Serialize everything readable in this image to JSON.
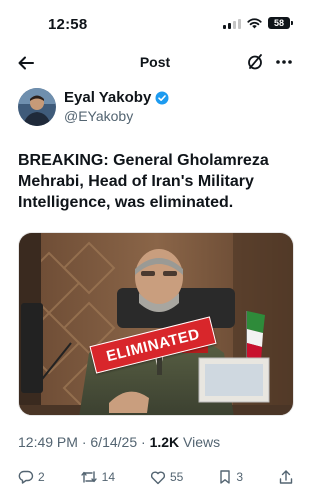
{
  "status_bar": {
    "time": "12:58",
    "battery": "58"
  },
  "nav": {
    "title": "Post",
    "back_icon": "back-arrow-icon",
    "grok_icon": "grok-icon",
    "more_icon": "more-icon"
  },
  "author": {
    "display_name": "Eyal Yakoby",
    "handle": "@EYakoby",
    "verified_color": "#1d9bf0"
  },
  "tweet": {
    "text": "BREAKING: General Gholamreza Mehrabi, Head of Iran's Military Intelligence, was eliminated.",
    "media_label": "ELIMINATED"
  },
  "meta": {
    "time": "12:49 PM",
    "sep1": " · ",
    "date": "6/14/25",
    "sep2": " · ",
    "views_count": "1.2K",
    "views_label": " Views"
  },
  "actions": {
    "replies": "2",
    "reposts": "14",
    "likes": "55",
    "bookmarks": "3"
  }
}
